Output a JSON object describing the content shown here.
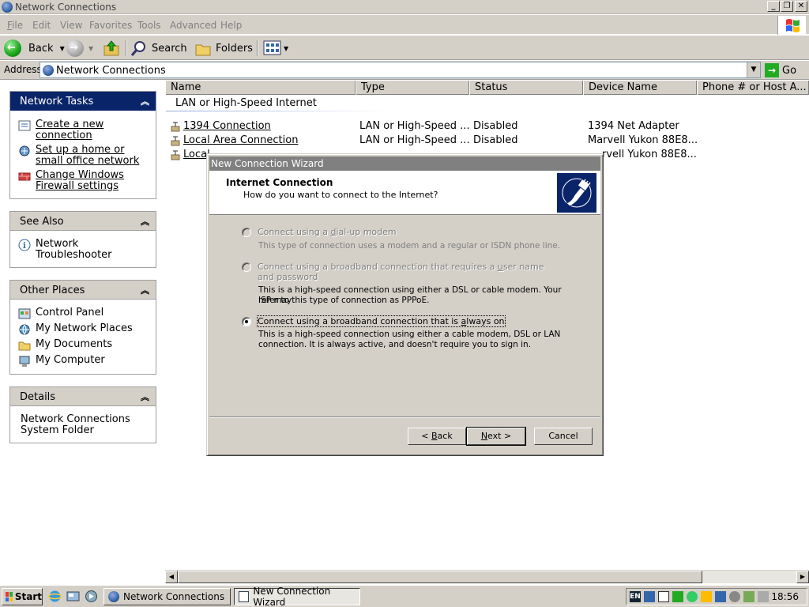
{
  "window": {
    "title": "Network Connections",
    "controls": {
      "minimize": "_",
      "restore": "❐",
      "close": "✕"
    }
  },
  "menubar": {
    "items": [
      "File",
      "Edit",
      "View",
      "Favorites",
      "Tools",
      "Advanced",
      "Help"
    ]
  },
  "toolbar": {
    "back": "Back",
    "search": "Search",
    "folders": "Folders"
  },
  "address": {
    "label": "Address",
    "value": "Network Connections",
    "go": "Go"
  },
  "left": {
    "network_tasks": {
      "header": "Network Tasks",
      "items": [
        {
          "line1": "Create a new",
          "line2": "connection",
          "icon": "new-connection-icon"
        },
        {
          "line1": "Set up a home or",
          "line2": "small office network",
          "icon": "home-network-icon"
        },
        {
          "line1": "Change Windows",
          "line2": "Firewall settings",
          "icon": "firewall-icon"
        }
      ]
    },
    "see_also": {
      "header": "See Also",
      "items": [
        {
          "line1": "Network",
          "line2": "Troubleshooter",
          "icon": "info-icon"
        }
      ]
    },
    "other_places": {
      "header": "Other Places",
      "items": [
        "Control Panel",
        "My Network Places",
        "My Documents",
        "My Computer"
      ]
    },
    "details": {
      "header": "Details",
      "line1": "Network Connections",
      "line2": "System Folder"
    }
  },
  "list": {
    "columns": [
      "Name",
      "Type",
      "Status",
      "Device Name",
      "Phone # or Host A..."
    ],
    "group": "LAN or High-Speed Internet",
    "rows": [
      {
        "name": "1394 Connection",
        "type": "LAN or High-Speed ...",
        "status": "Disabled",
        "device": "1394 Net Adapter"
      },
      {
        "name": "Local Area Connection",
        "type": "LAN or High-Speed ...",
        "status": "Disabled",
        "device": "Marvell Yukon 88E8..."
      },
      {
        "name": "Local",
        "type": "",
        "status": "",
        "device": "rvell Yukon 88E8..."
      }
    ]
  },
  "dialog": {
    "title": "New Connection Wizard",
    "heading": "Internet Connection",
    "subheading": "How do you want to connect to the Internet?",
    "options": [
      {
        "label_pre": "Connect using a ",
        "label_key": "d",
        "label_post": "ial-up modem",
        "desc1": "This type of connection uses a modem and a regular or ISDN phone line.",
        "desc2": "",
        "enabled": false,
        "selected": false
      },
      {
        "label_pre": "Connect using a broadband connection that requires a ",
        "label_key": "u",
        "label_post": "ser name",
        "label_line2": "and password",
        "desc1": "This is a high-speed connection using either a DSL or cable modem. Your ISP may",
        "desc2": "refer to this type of connection as PPPoE.",
        "enabled": false,
        "selected": false
      },
      {
        "label_pre": "Connect using a broadband connection that is ",
        "label_key": "a",
        "label_post": "lways on",
        "desc1": "This is a high-speed connection using either a cable modem, DSL or LAN",
        "desc2": "connection. It is always active, and doesn't require you to sign in.",
        "enabled": true,
        "selected": true
      }
    ],
    "buttons": {
      "back_pre": "< ",
      "back_key": "B",
      "back_post": "ack",
      "next_key": "N",
      "next_post": "ext >",
      "cancel": "Cancel"
    }
  },
  "taskbar": {
    "start": "Start",
    "tasks": [
      "Network Connections",
      "New Connection Wizard"
    ],
    "clock": "18:56",
    "lang": "EN"
  }
}
